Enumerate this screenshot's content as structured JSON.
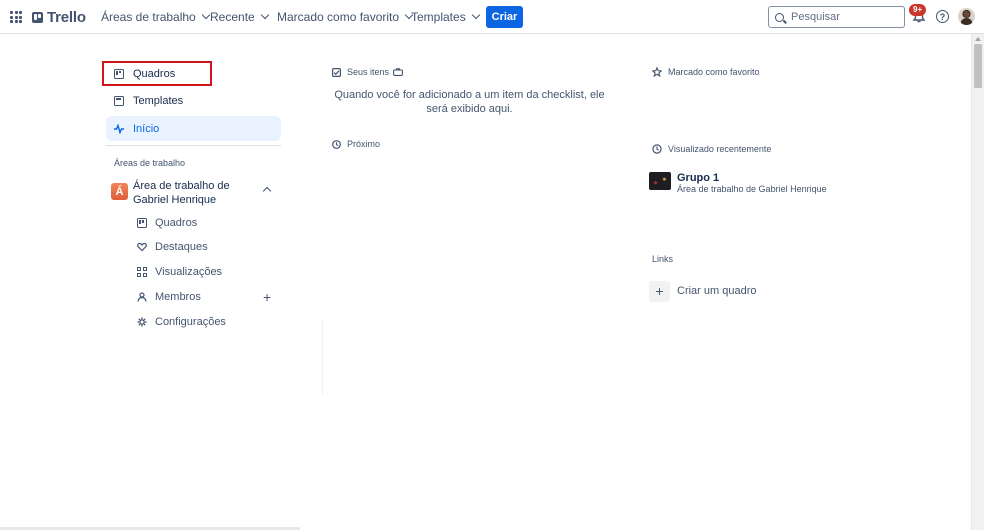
{
  "header": {
    "logo_text": "Trello",
    "nav": [
      {
        "label": "Áreas de trabalho"
      },
      {
        "label": "Recente"
      },
      {
        "label": "Marcado como favorito"
      },
      {
        "label": "Templates"
      }
    ],
    "create_label": "Criar",
    "search_placeholder": "Pesquisar",
    "notification_badge": "9+",
    "help_glyph": "?"
  },
  "sidebar": {
    "items": [
      {
        "label": "Quadros",
        "icon": "board-icon"
      },
      {
        "label": "Templates",
        "icon": "template-icon"
      },
      {
        "label": "Início",
        "icon": "activity-icon",
        "active": true
      }
    ],
    "workspaces_label": "Áreas de trabalho",
    "workspace": {
      "initial": "Á",
      "name": "Área de trabalho de Gabriel Henrique",
      "badge_color": "#e9704a",
      "subitems": [
        {
          "label": "Quadros",
          "icon": "board-icon"
        },
        {
          "label": "Destaques",
          "icon": "heart-icon"
        },
        {
          "label": "Visualizações",
          "icon": "views-grid-icon"
        },
        {
          "label": "Membros",
          "icon": "members-icon"
        },
        {
          "label": "Configurações",
          "icon": "gear-icon"
        }
      ],
      "add_member_glyph": "+"
    }
  },
  "middle": {
    "my_items_label": "Seus itens",
    "my_items_empty": "Quando você for adicionado a um item da checklist, ele será exibido aqui.",
    "upcoming_label": "Próximo"
  },
  "right": {
    "starred_label": "Marcado como favorito",
    "recent_label": "Visualizado recentemente",
    "recent_board": {
      "title": "Grupo 1",
      "workspace": "Área de trabalho de Gabriel Henrique"
    },
    "links_label": "Links",
    "create_board_label": "Criar um quadro",
    "create_board_glyph": "+"
  },
  "colors": {
    "accent": "#0c66e4",
    "active_bg": "#e9f2ff",
    "highlight_outline": "#d0161c",
    "badge_red": "#c9372c"
  }
}
